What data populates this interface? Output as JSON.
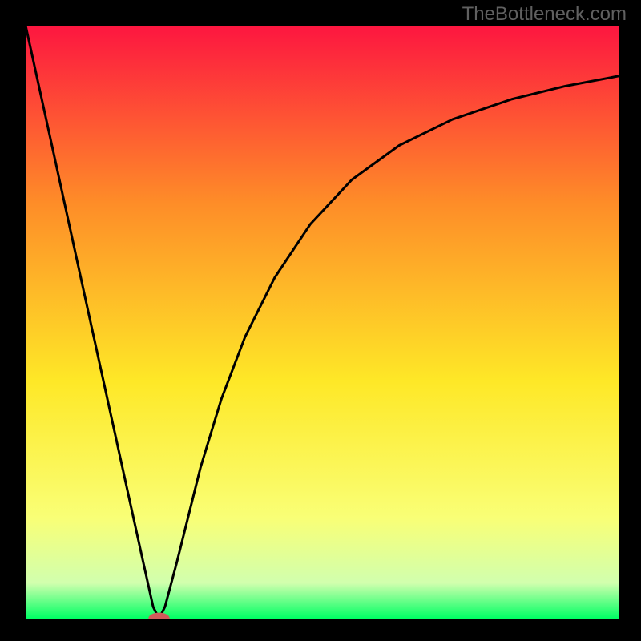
{
  "watermark": "TheBottleneck.com",
  "chart_data": {
    "type": "line",
    "title": "",
    "xlabel": "",
    "ylabel": "",
    "xlim": [
      0,
      1
    ],
    "ylim": [
      0,
      1
    ],
    "gradient_colors": {
      "top": "#fd1640",
      "mid_top": "#fe8d28",
      "mid": "#fee827",
      "mid_low": "#f9ff76",
      "band_light": "#d1ffae",
      "bottom": "#00ff64"
    },
    "series": [
      {
        "name": "curve",
        "color": "#000000",
        "x": [
          0.0,
          0.05,
          0.1,
          0.15,
          0.195,
          0.215,
          0.225,
          0.235,
          0.255,
          0.275,
          0.295,
          0.33,
          0.37,
          0.42,
          0.48,
          0.55,
          0.63,
          0.72,
          0.82,
          0.91,
          1.0
        ],
        "y": [
          1.0,
          0.772,
          0.543,
          0.315,
          0.11,
          0.02,
          0.0,
          0.02,
          0.095,
          0.175,
          0.255,
          0.37,
          0.475,
          0.575,
          0.665,
          0.74,
          0.798,
          0.842,
          0.876,
          0.898,
          0.915
        ]
      }
    ],
    "marker": {
      "name": "min-point",
      "color": "#d15a5a",
      "x": 0.225,
      "y": 0.0,
      "rx": 0.018,
      "ry": 0.01
    }
  }
}
